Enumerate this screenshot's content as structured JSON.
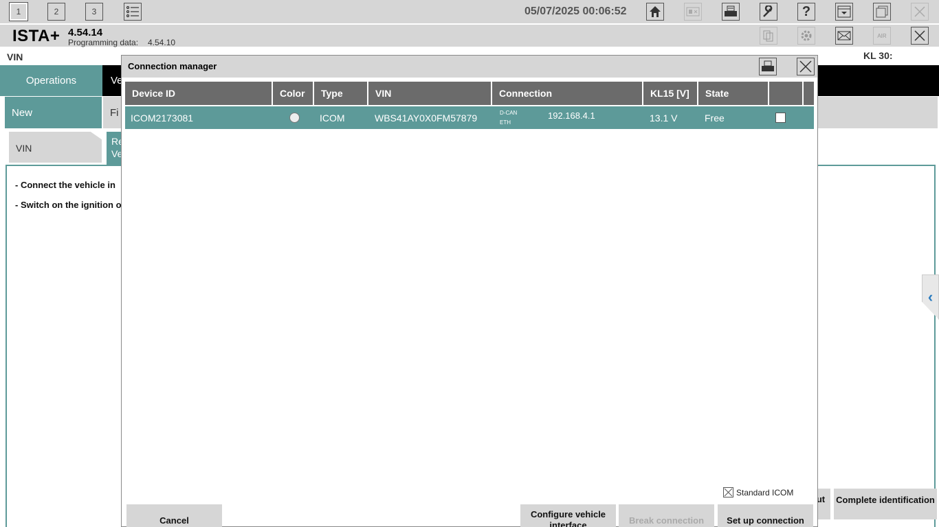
{
  "topbar": {
    "workspaces": [
      "1",
      "2",
      "3"
    ],
    "datetime": "05/07/2025 00:06:52",
    "icons": [
      "list-icon",
      "home-icon",
      "display-icon",
      "printer-icon",
      "wrench-icon",
      "help-icon",
      "dropdown-icon",
      "window-icon",
      "close-icon"
    ]
  },
  "appbar": {
    "app_name": "ISTA+",
    "version": "4.54.14",
    "programming_label": "Programming data:",
    "programming_value": "4.54.10",
    "icons": [
      "document-icon",
      "gear-icon",
      "mail-icon",
      "air-icon",
      "close-icon"
    ]
  },
  "background": {
    "vin_label": "VIN",
    "kl30_label": "KL 30:",
    "tab_operations": "Operations",
    "tab_partial": "Ve",
    "sub_new": "New",
    "sub_partial": "Fi",
    "step_vin": "VIN",
    "step_partial": "Re Ve",
    "instruction_1": "- Connect the vehicle in",
    "instruction_2": "- Switch on the ignition o",
    "btn_partial": "ut",
    "btn_complete": "Complete identification"
  },
  "dialog": {
    "title": "Connection manager",
    "columns": [
      "Device ID",
      "Color",
      "Type",
      "VIN",
      "Connection",
      "KL15 [V]",
      "State"
    ],
    "rows": [
      {
        "device_id": "ICOM2173081",
        "type": "ICOM",
        "vin": "WBS41AY0X0FM57879",
        "conn_dcan": "D-CAN",
        "conn_eth": "ETH",
        "ip": "192.168.4.1",
        "kl15": "13.1 V",
        "state": "Free"
      }
    ],
    "standard_icom_label": "Standard ICOM",
    "buttons": {
      "cancel": "Cancel",
      "configure": "Configure vehicle interface",
      "break": "Break connection",
      "setup": "Set up connection"
    }
  }
}
